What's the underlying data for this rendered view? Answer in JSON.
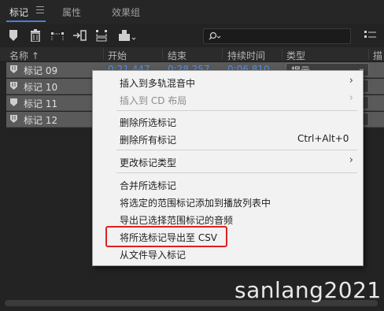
{
  "tabs": [
    {
      "label": "标记"
    },
    {
      "label": "属性"
    },
    {
      "label": "效果组"
    }
  ],
  "search": {
    "placeholder": ""
  },
  "columns": {
    "name": "名称 ↑",
    "start": "开始",
    "end": "结束",
    "duration": "持续时间",
    "type": "类型",
    "extra": "描"
  },
  "rows": [
    {
      "name": "标记 09",
      "start": "0:21.447",
      "end": "0:28.257",
      "duration": "0:06.810",
      "type": "提示"
    },
    {
      "name": "标记 10",
      "start": "",
      "end": "",
      "duration": "",
      "type": ""
    },
    {
      "name": "标记 11",
      "start": "",
      "end": "",
      "duration": "",
      "type": ""
    },
    {
      "name": "标记 12",
      "start": "",
      "end": "",
      "duration": "",
      "type": ""
    }
  ],
  "context_menu": {
    "items": [
      {
        "label": "插入到多轨混音中",
        "has_submenu": true,
        "disabled": false
      },
      {
        "label": "插入到 CD 布局",
        "has_submenu": true,
        "disabled": true
      },
      {
        "label": "删除所选标记",
        "has_submenu": false,
        "disabled": false
      },
      {
        "label": "删除所有标记",
        "shortcut": "Ctrl+Alt+0",
        "has_submenu": false,
        "disabled": false
      },
      {
        "label": "更改标记类型",
        "has_submenu": true,
        "disabled": false
      },
      {
        "label": "合并所选标记",
        "has_submenu": false,
        "disabled": false
      },
      {
        "label": "将选定的范围标记添加到播放列表中",
        "has_submenu": false,
        "disabled": false
      },
      {
        "label": "导出已选择范围标记的音频",
        "has_submenu": false,
        "disabled": false
      },
      {
        "label": "将所选标记导出至 CSV",
        "has_submenu": false,
        "disabled": false
      },
      {
        "label": "从文件导入标记",
        "has_submenu": false,
        "disabled": false
      }
    ],
    "submenu_arrow": "›"
  },
  "highlight_color": "#e02020",
  "accent_color": "#4f8fe8",
  "watermark": "sanlang2021",
  "icons": [
    "marker-icon",
    "trash-icon",
    "split-marker-icon",
    "insert-icon",
    "merge-icon",
    "export-icon",
    "search-icon",
    "filter-icon",
    "menu-icon"
  ]
}
